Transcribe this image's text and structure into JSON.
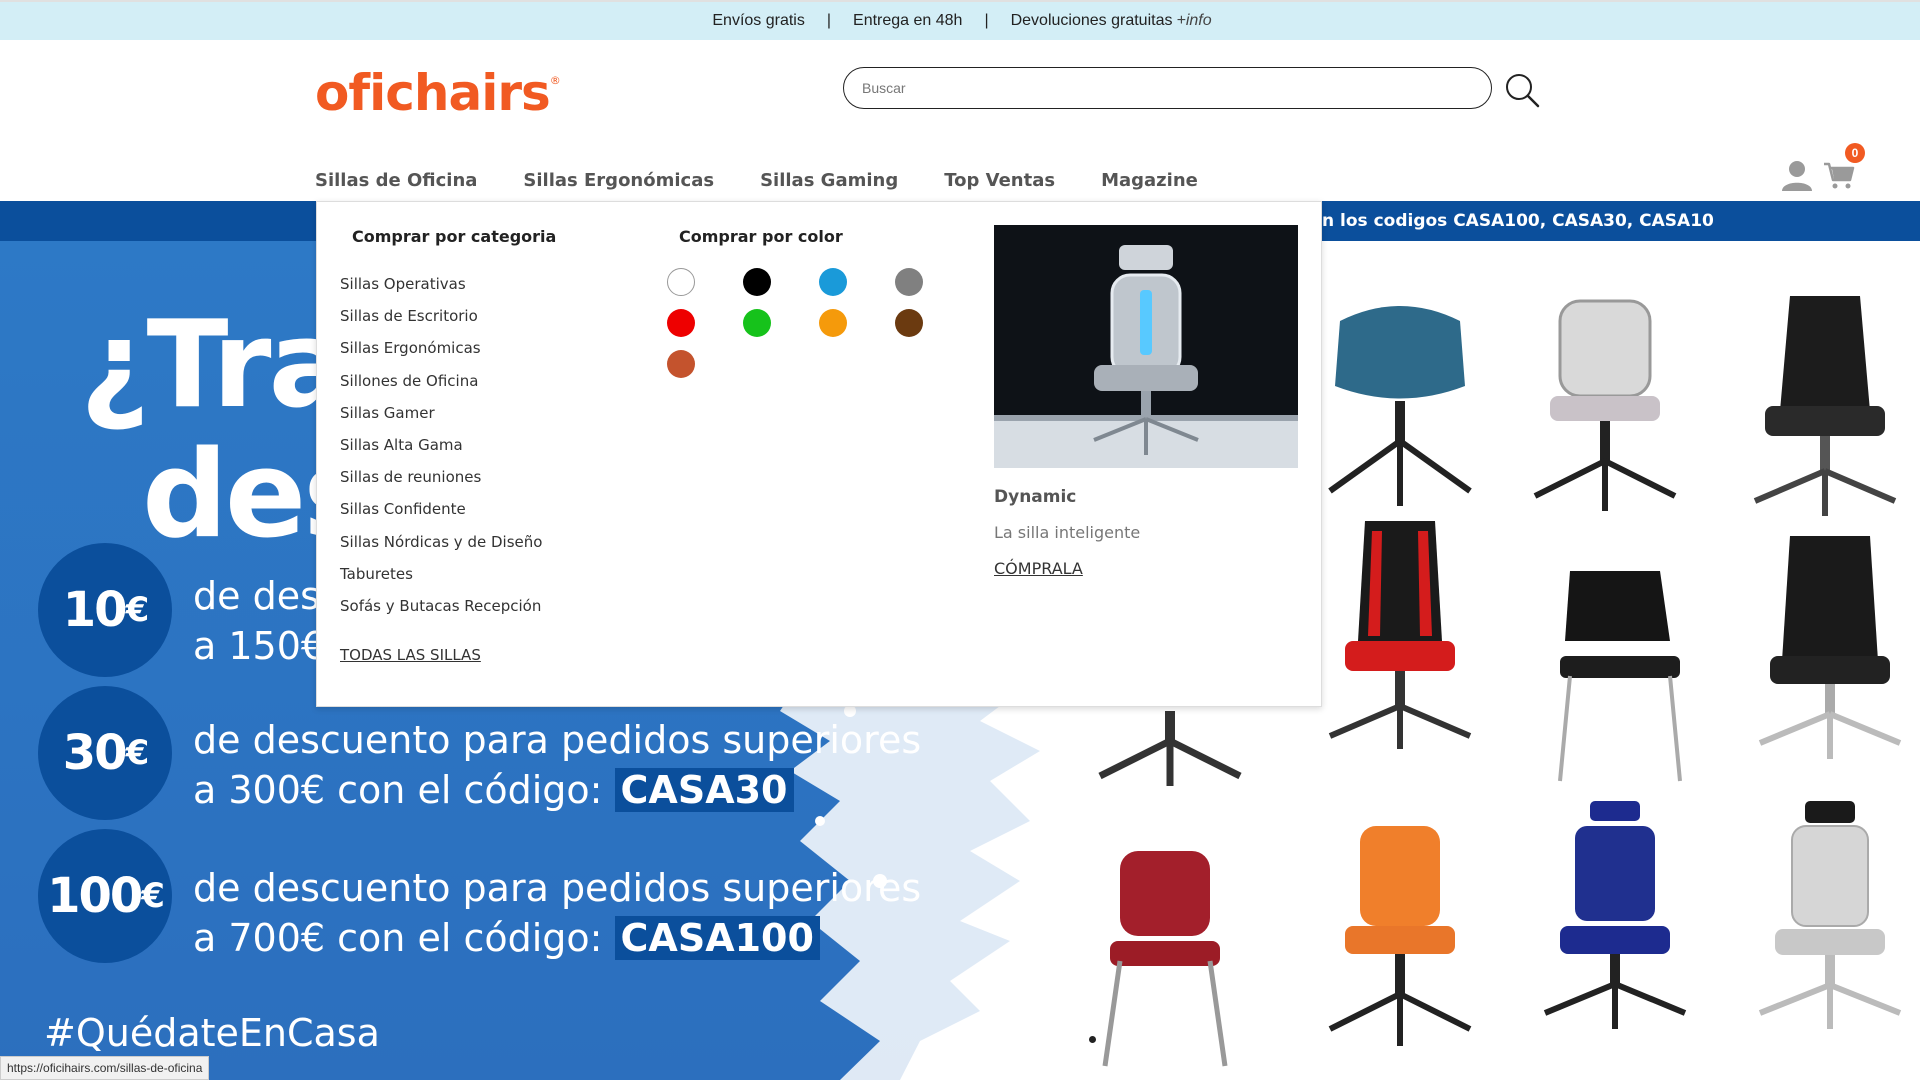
{
  "topbar": {
    "free_shipping": "Envíos gratis",
    "sep": "|",
    "delivery": "Entrega en 48h",
    "returns": "Devoluciones gratuitas",
    "info": "+info"
  },
  "header": {
    "logo": "oficha",
    "logo_rest": "irs",
    "logo_mark": "®",
    "search_placeholder": "Buscar",
    "cart_count": "0"
  },
  "nav": {
    "items": [
      "Sillas de Oficina",
      "Sillas Ergonómicas",
      "Sillas Gaming",
      "Top Ventas",
      "Magazine"
    ]
  },
  "promo_strip": "n los codigos CASA100, CASA30, CASA10",
  "dropdown": {
    "category_heading": "Comprar por categoria",
    "color_heading": "Comprar por color",
    "categories": [
      "Sillas Operativas",
      "Sillas de Escritorio",
      "Sillas Ergonómicas",
      "Sillones de Oficina",
      "Sillas Gamer",
      "Sillas Alta Gama",
      "Sillas de reuniones",
      "Sillas Confidente",
      "Sillas Nórdicas y de Diseño",
      "Taburetes",
      "Sofás y Butacas Recepción"
    ],
    "all_link": "TODAS LAS SILLAS",
    "colors": [
      "#ffffff",
      "#000000",
      "#1a9ad9",
      "#808080",
      "#ee0000",
      "#16c21b",
      "#f59a0b",
      "#6b3a10",
      "#c4532d"
    ],
    "featured": {
      "name": "Dynamic",
      "subtitle": "La silla inteligente",
      "cta": "CÓMPRALA"
    }
  },
  "banner": {
    "title_line1": "¿Tra",
    "title_line2": "des",
    "offers": [
      {
        "amount": "10",
        "currency": "€",
        "line1": "de des",
        "line2": "a 150€",
        "code": ""
      },
      {
        "amount": "30",
        "currency": "€",
        "line1": "de descuento para pedidos superiores",
        "line2": "a 300€ con el código: ",
        "code": "CASA30"
      },
      {
        "amount": "100",
        "currency": "€",
        "line1": "de descuento para pedidos superiores",
        "line2": "a 700€ con el código: ",
        "code": "CASA100"
      }
    ],
    "hashtag": "#QuédateEnCasa"
  },
  "status_url": "https://oficihairs.com/sillas-de-oficina",
  "theme": {
    "brand_orange": "#f15a22",
    "brand_blue": "#0b4f9c",
    "topbar_bg": "#d3eef6"
  }
}
